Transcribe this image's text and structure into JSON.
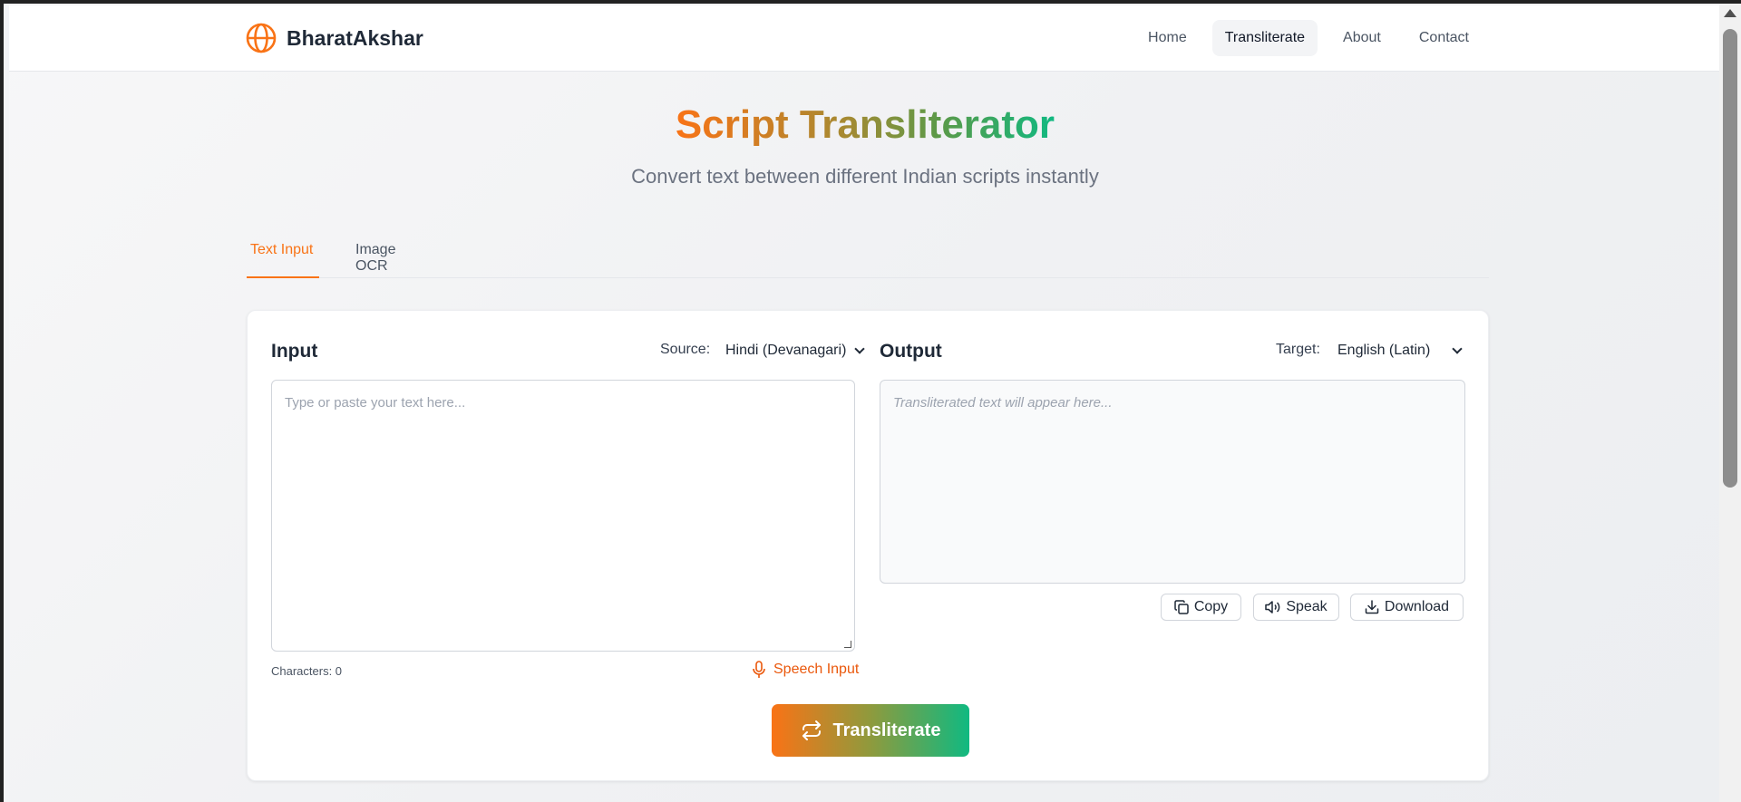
{
  "header": {
    "brand_name": "BharatAkshar",
    "nav": [
      {
        "label": "Home"
      },
      {
        "label": "Transliterate",
        "active": true
      },
      {
        "label": "About"
      },
      {
        "label": "Contact"
      }
    ]
  },
  "hero": {
    "title": "Script Transliterator",
    "subtitle": "Convert text between different Indian scripts instantly"
  },
  "tabs": [
    {
      "label": "Text Input",
      "active": true
    },
    {
      "label": "Image OCR",
      "active": false
    }
  ],
  "input": {
    "title": "Input",
    "source_label": "Source:",
    "source_value": "Hindi (Devanagari)",
    "placeholder": "Type or paste your text here...",
    "char_count": "Characters: 0",
    "speech_label": "Speech Input"
  },
  "output": {
    "title": "Output",
    "target_label": "Target:",
    "target_value": "English (Latin)",
    "placeholder": "Transliterated text will appear here...",
    "copy_label": "Copy",
    "speak_label": "Speak",
    "download_label": "Download"
  },
  "transliterate_label": "Transliterate",
  "colors": {
    "accent": "#f97316",
    "gradient_end": "#10b981"
  },
  "icons": [
    "globe-icon",
    "mic-icon",
    "copy-icon",
    "speaker-icon",
    "download-icon",
    "swap-icon",
    "chevron-down-icon"
  ]
}
